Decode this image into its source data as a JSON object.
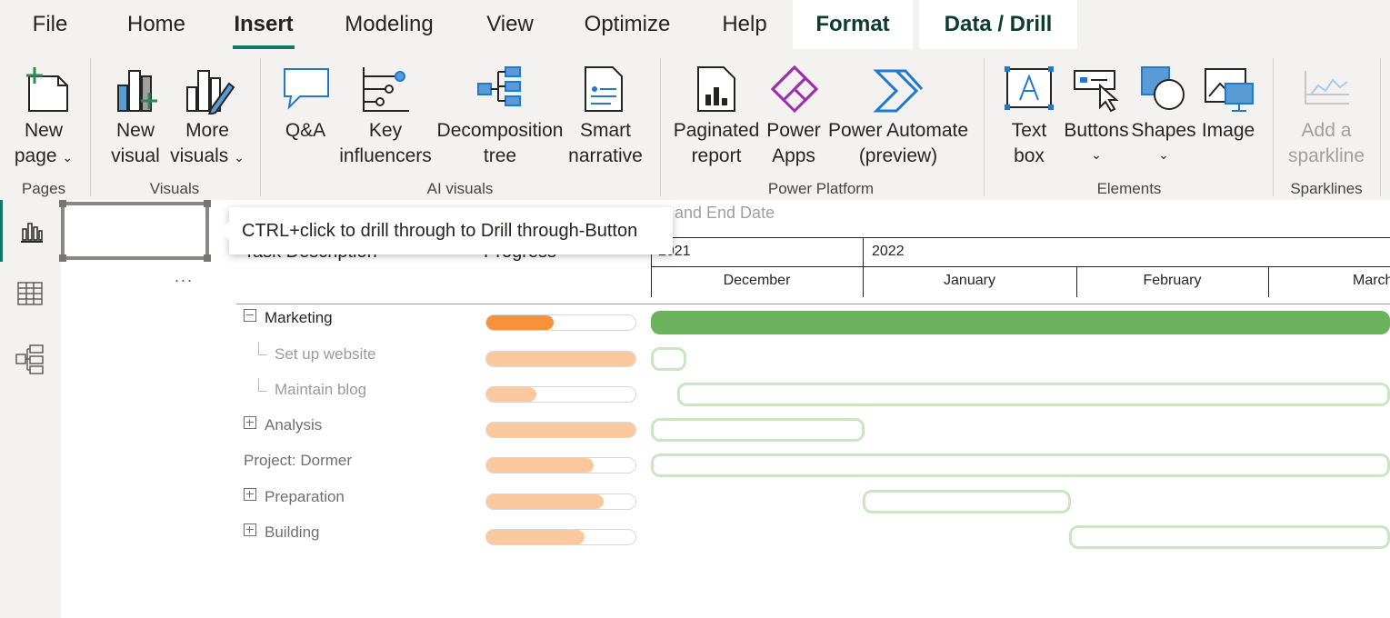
{
  "menu": {
    "tabs": [
      "File",
      "Home",
      "Insert",
      "Modeling",
      "View",
      "Optimize",
      "Help",
      "Format",
      "Data / Drill"
    ],
    "active": "Insert"
  },
  "ribbon": {
    "groups": {
      "pages": "Pages",
      "visuals": "Visuals",
      "ai_visuals": "AI visuals",
      "power_platform": "Power Platform",
      "elements": "Elements",
      "sparklines": "Sparklines"
    },
    "buttons": {
      "new_page": [
        "New",
        "page"
      ],
      "new_visual": [
        "New",
        "visual"
      ],
      "more_visuals": [
        "More",
        "visuals"
      ],
      "qa": [
        "Q&A"
      ],
      "key_influencers": [
        "Key",
        "influencers"
      ],
      "decomposition_tree": [
        "Decomposition",
        "tree"
      ],
      "smart_narrative": [
        "Smart",
        "narrative"
      ],
      "paginated_report": [
        "Paginated",
        "report"
      ],
      "power_apps": [
        "Power",
        "Apps"
      ],
      "power_automate": [
        "Power Automate",
        "(preview)"
      ],
      "text_box": [
        "Text",
        "box"
      ],
      "buttons": [
        "Buttons"
      ],
      "shapes": [
        "Shapes"
      ],
      "image": [
        "Image"
      ],
      "add_sparkline": [
        "Add a",
        "sparkline"
      ]
    }
  },
  "tooltip": "CTRL+click to drill through to Drill through-Button",
  "more_options": "...",
  "visual": {
    "title_partial": "and End Date",
    "columns": {
      "task": "Task Description",
      "progress": "Progress"
    },
    "years": [
      "2021",
      "2022"
    ],
    "months": [
      "December",
      "January",
      "February",
      "March"
    ],
    "rows": [
      {
        "label": "Marketing",
        "progress": 0.45,
        "expander": "minus"
      },
      {
        "label": "Set up website",
        "progress": 1.0,
        "expander": "child"
      },
      {
        "label": "Maintain blog",
        "progress": 0.33,
        "expander": "child"
      },
      {
        "label": "Analysis",
        "progress": 1.0,
        "expander": "plus"
      },
      {
        "label": "Project: Dormer",
        "progress": 0.71,
        "expander": "none"
      },
      {
        "label": "Preparation",
        "progress": 0.78,
        "expander": "plus"
      },
      {
        "label": "Building",
        "progress": 0.65,
        "expander": "plus"
      }
    ]
  }
}
